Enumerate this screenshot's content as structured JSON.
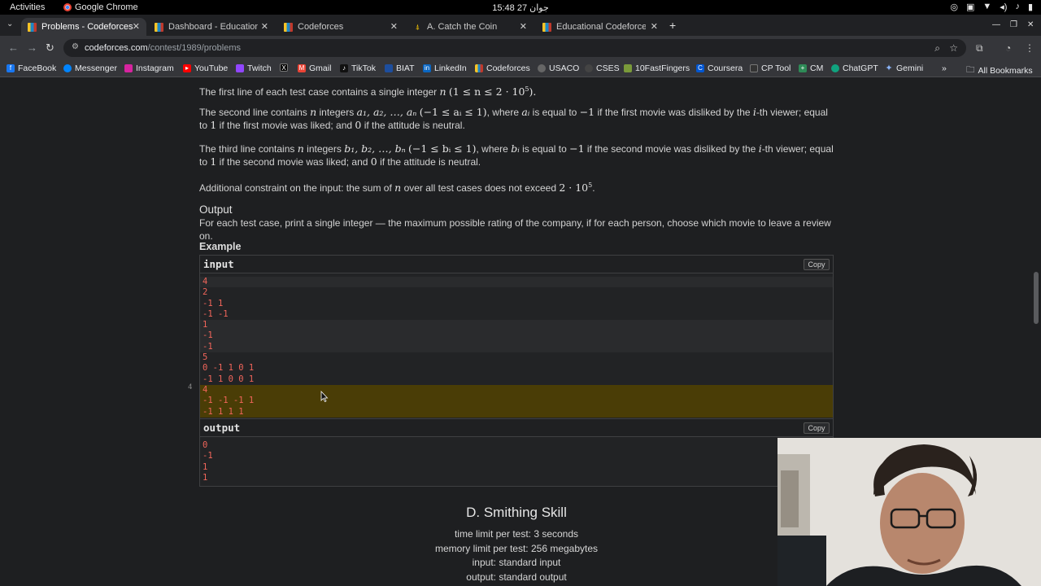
{
  "system": {
    "activities": "Activities",
    "app_name": "Google Chrome",
    "clock": "15:48  27 جوان"
  },
  "tabs": [
    {
      "label": "Problems - Codeforces",
      "active": true
    },
    {
      "label": "Dashboard - Educational",
      "active": false
    },
    {
      "label": "Codeforces",
      "active": false
    },
    {
      "label": "A. Catch the Coin",
      "active": false
    },
    {
      "label": "Educational Codeforces",
      "active": false
    }
  ],
  "omnibox": {
    "host": "codeforces.com",
    "path": "/contest/1989/problems"
  },
  "bookmarks": [
    {
      "label": "FaceBook",
      "color": "#1877f2"
    },
    {
      "label": "Messenger",
      "color": "#0084ff"
    },
    {
      "label": "Instagram",
      "color": "#d6249f"
    },
    {
      "label": "YouTube",
      "color": "#ff0000"
    },
    {
      "label": "Twitch",
      "color": "#9146ff"
    },
    {
      "label": "X",
      "color": "#000000"
    },
    {
      "label": "Gmail",
      "color": "#ea4335"
    },
    {
      "label": "TikTok",
      "color": "#111111"
    },
    {
      "label": "BIAT",
      "color": "#1d4e9e"
    },
    {
      "label": "LinkedIn",
      "color": "#0a66c2"
    },
    {
      "label": "Codeforces",
      "color": "#1b88c8"
    },
    {
      "label": "USACO",
      "color": "#666666"
    },
    {
      "label": "CSES",
      "color": "#444444"
    },
    {
      "label": "10FastFingers",
      "color": "#7a9a3a"
    },
    {
      "label": "Coursera",
      "color": "#0056d2"
    },
    {
      "label": "CP Tool",
      "color": "#333333"
    },
    {
      "label": "CM",
      "color": "#2e8b57"
    },
    {
      "label": "ChatGPT",
      "color": "#10a37f"
    },
    {
      "label": "Gemini",
      "color": "#8ab4f8"
    }
  ],
  "bookmarks_more": "»",
  "all_bookmarks": "All Bookmarks",
  "problem": {
    "p1": {
      "a": "The first line of each test case contains a single integer",
      "n": "n",
      "cons": "(1 ≤ n ≤ 2 · 10",
      "exp": "5",
      "end": ")."
    },
    "p2": {
      "a": "The second line contains",
      "n": "n",
      "b": "integers",
      "seq": "a",
      "seq_text": "₁, a₂, …, aₙ",
      "cons": "(−1 ≤ aᵢ ≤ 1)",
      "c": ", where",
      "ai": "aᵢ",
      "d": "is equal to",
      "neg1": "−1",
      "e": "if the first movie was disliked by the",
      "i": "i",
      "f": "-th viewer; equal to",
      "one": "1",
      "g": "if the first movie was liked; and",
      "zero": "0",
      "h": "if the attitude is neutral."
    },
    "p3": {
      "a": "The third line contains",
      "n": "n",
      "b": "integers",
      "seq": "b₁, b₂, …, bₙ",
      "cons": "(−1 ≤ bᵢ ≤ 1)",
      "c": ", where",
      "bi": "bᵢ",
      "d": "is equal to",
      "neg1": "−1",
      "e": "if the second movie was disliked by the",
      "i": "i",
      "f": "-th viewer; equal to",
      "one": "1",
      "g": "if the second movie was liked; and",
      "zero": "0",
      "h": "if the attitude is neutral."
    },
    "p4": {
      "a": "Additional constraint on the input: the sum of",
      "n": "n",
      "b": "over all test cases does not exceed",
      "val": "2 · 10",
      "exp": "5",
      "end": "."
    },
    "output_title": "Output",
    "output_text": "For each test case, print a single integer — the maximum possible rating of the company, if for each person, choose which movie to leave a review on.",
    "example_title": "Example",
    "input_label": "input",
    "output_label": "output",
    "copy_label": "Copy",
    "line_number": "4",
    "input_groups": [
      [
        "4"
      ],
      [
        "2",
        "-1 1",
        "-1 -1"
      ],
      [
        "1",
        "-1",
        "-1"
      ],
      [
        "5",
        "0 -1 1 0 1",
        "-1 1 0 0 1"
      ],
      [
        "4",
        "-1 -1 -1 1",
        "-1 1 1 1"
      ]
    ],
    "output_lines": [
      "0",
      "-1",
      "1",
      "1"
    ],
    "next_title": "D. Smithing Skill",
    "time_limit": "time limit per test: 3 seconds",
    "memory_limit": "memory limit per test: 256 megabytes",
    "input_spec": "input: standard input",
    "output_spec": "output: standard output"
  }
}
